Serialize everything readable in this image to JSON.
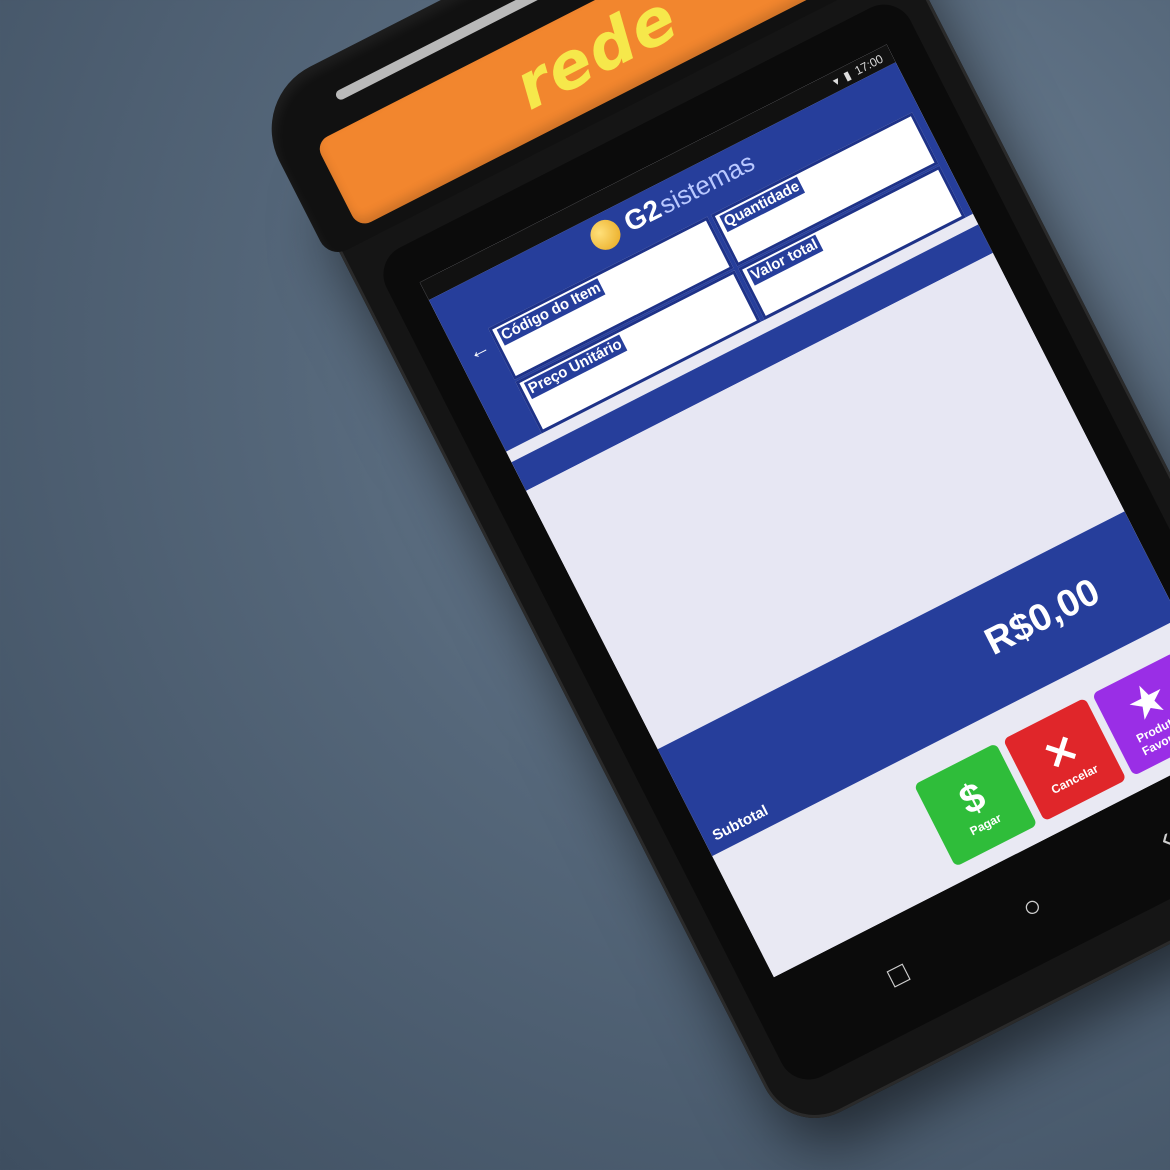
{
  "brand": {
    "logo_text": "rede"
  },
  "status_bar": {
    "time": "17:00"
  },
  "app": {
    "logo_text": "G2",
    "logo_sub": "sistemas",
    "back_icon": "arrow-left-icon"
  },
  "form": {
    "codigo_label": "Código do Item",
    "codigo_value": "",
    "quantidade_label": "Quantidade",
    "quantidade_value": "",
    "preco_label": "Preço Unitário",
    "preco_value": "",
    "valor_label": "Valor total",
    "valor_value": ""
  },
  "subtotal": {
    "label": "Subtotal",
    "value": "R$0,00"
  },
  "actions": [
    {
      "label": "Pagar",
      "icon": "$",
      "color": "#2fbd3a"
    },
    {
      "label": "Cancelar",
      "icon": "✕",
      "color": "#e0262a"
    },
    {
      "label": "Produtos Favoritos",
      "icon": "★",
      "color": "#9a2ee6"
    }
  ],
  "navkeys": {
    "back": "‹",
    "home": "○",
    "recent": "□"
  }
}
